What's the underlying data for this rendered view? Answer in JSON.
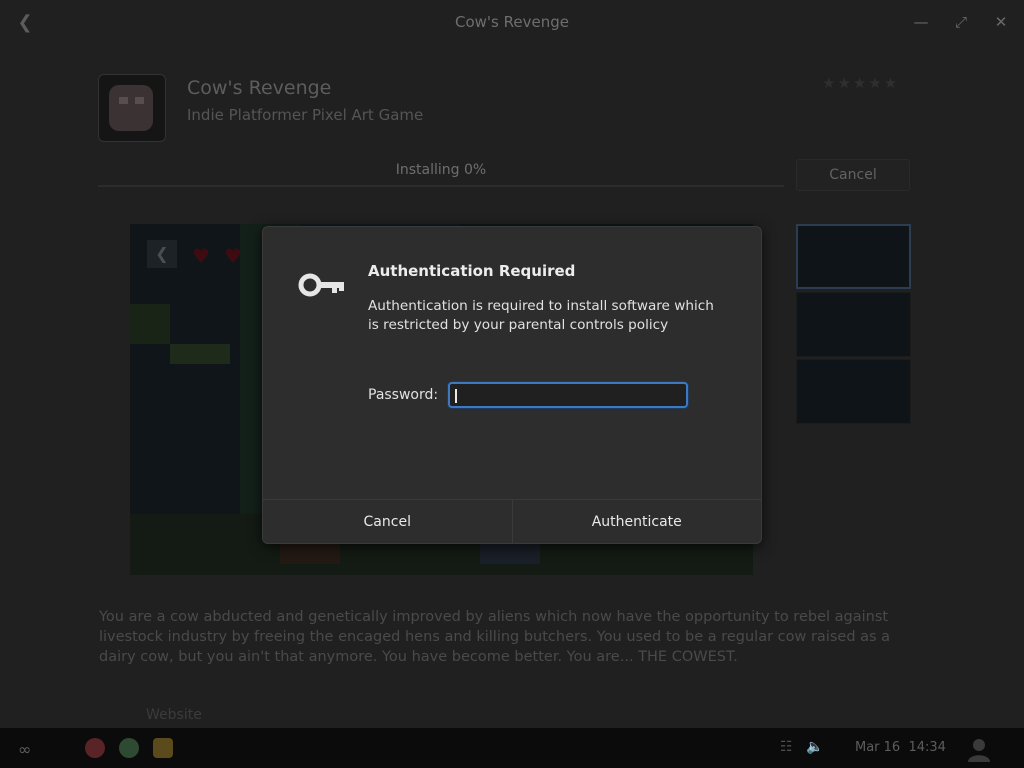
{
  "window": {
    "title": "Cow's Revenge",
    "back_icon": "back-arrow-icon",
    "minimize_icon": "minimize-icon",
    "restore_icon": "restore-icon",
    "close_icon": "close-icon"
  },
  "app": {
    "name": "Cow's Revenge",
    "subtitle": "Indie Platformer Pixel Art Game",
    "rating_stars": 5,
    "progress_label": "Installing 0%",
    "progress_value": 0,
    "cancel_label": "Cancel",
    "description": "You are a cow abducted and genetically improved by aliens which now have the opportunity to rebel against livestock industry by freeing the encaged hens and killing butchers. You used to be a regular cow raised as a dairy cow, but you ain't that anymore. You have become better. You are... THE COWEST.",
    "website_label": "Website",
    "screenshots_count": 3,
    "selected_screenshot": 1
  },
  "dialog": {
    "title": "Authentication Required",
    "message": "Authentication is required to install software which is restricted by your parental controls policy",
    "password_label": "Password:",
    "password_value": "",
    "cancel_label": "Cancel",
    "authenticate_label": "Authenticate",
    "icon": "key-icon",
    "focus_color": "#3d78c1"
  },
  "taskbar": {
    "date": "Mar 16",
    "time": "14:34",
    "pinned_apps": [
      "app-center-icon",
      "chrome-icon",
      "files-icon"
    ],
    "system_icons": [
      "network-icon",
      "volume-icon",
      "user-icon"
    ]
  }
}
